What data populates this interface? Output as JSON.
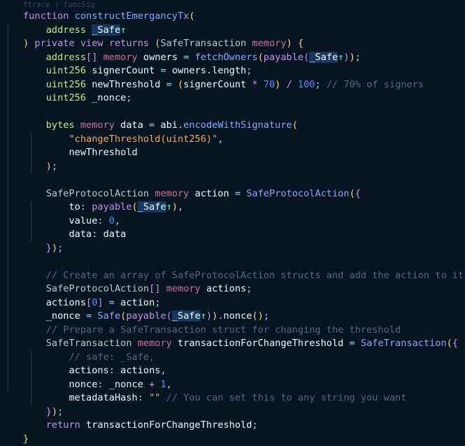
{
  "editor": {
    "language": "solidity",
    "background_color": "#071522",
    "foreground_color": "#c5d1de",
    "indent_guide_color": "#27384b",
    "selection_highlight_color": "#17375e"
  },
  "codelens": {
    "items": [
      "ftrace",
      "funcSig"
    ],
    "separator": "|",
    "text": "ftrace | funcSig",
    "color": "#2c4a63"
  },
  "highlighted_symbol": {
    "name": "_Safe",
    "caret_glyph": "↑",
    "caret_color": "#3fd0b0",
    "occurrences": 4
  },
  "syntax_colors": {
    "keyword": "#c792ea",
    "type": "#c3e88d",
    "type_struct": "#b2ccd6",
    "function": "#82aaff",
    "identifier": "#eeffff",
    "number": "#5c8aff",
    "string": "#f0a868",
    "comment": "#4e6a85",
    "punctuation": "#89ddff",
    "bracket_yellow": "#ffd479",
    "bracket_purple": "#c792ea",
    "memory_keyword": "#d16d9e"
  },
  "code": {
    "lines": [
      "function constructEmergancyTx(",
      "    address _Safe",
      ") private view returns (SafeTransaction memory) {",
      "    address[] memory owners = fetchOwners(payable(_Safe));",
      "    uint256 signerCount = owners.length;",
      "    uint256 newThreshold = (signerCount * 70) / 100; // 70% of signers",
      "    uint256 _nonce;",
      "",
      "    bytes memory data = abi.encodeWithSignature(",
      "        \"changeThreshold(uint256)\",",
      "        newThreshold",
      "    );",
      "",
      "    SafeProtocolAction memory action = SafeProtocolAction({",
      "        to: payable(_Safe),",
      "        value: 0,",
      "        data: data",
      "    });",
      "",
      "    // Create an array of SafeProtocolAction structs and add the action to it",
      "    SafeProtocolAction[] memory actions;",
      "    actions[0] = action;",
      "    _nonce = Safe(payable(_Safe)).nonce();",
      "    // Prepare a SafeTransaction struct for changing the threshold",
      "    SafeTransaction memory transactionForChangeThreshold = SafeTransaction({",
      "        // safe: _Safe,",
      "        actions: actions,",
      "        nonce: _nonce + 1,",
      "        metadataHash: \"\" // You can set this to any string you want",
      "    });",
      "    return transactionForChangeThreshold;",
      "}"
    ],
    "literals": {
      "string_signature": "\"changeThreshold(uint256)\"",
      "string_empty": "\"\"",
      "numbers": [
        "70",
        "100",
        "0",
        "0",
        "1"
      ]
    },
    "comments": [
      "// 70% of signers",
      "// Create an array of SafeProtocolAction structs and add the action to it",
      "// Prepare a SafeTransaction struct for changing the threshold",
      "// safe: _Safe,",
      "// You can set this to any string you want"
    ],
    "identifiers": [
      "constructEmergancyTx",
      "_Safe",
      "SafeTransaction",
      "owners",
      "fetchOwners",
      "signerCount",
      "newThreshold",
      "_nonce",
      "data",
      "abi",
      "encodeWithSignature",
      "SafeProtocolAction",
      "action",
      "actions",
      "Safe",
      "nonce",
      "transactionForChangeThreshold",
      "metadataHash"
    ],
    "keywords": [
      "function",
      "address",
      "private",
      "view",
      "returns",
      "memory",
      "payable",
      "uint256",
      "bytes",
      "return"
    ]
  }
}
